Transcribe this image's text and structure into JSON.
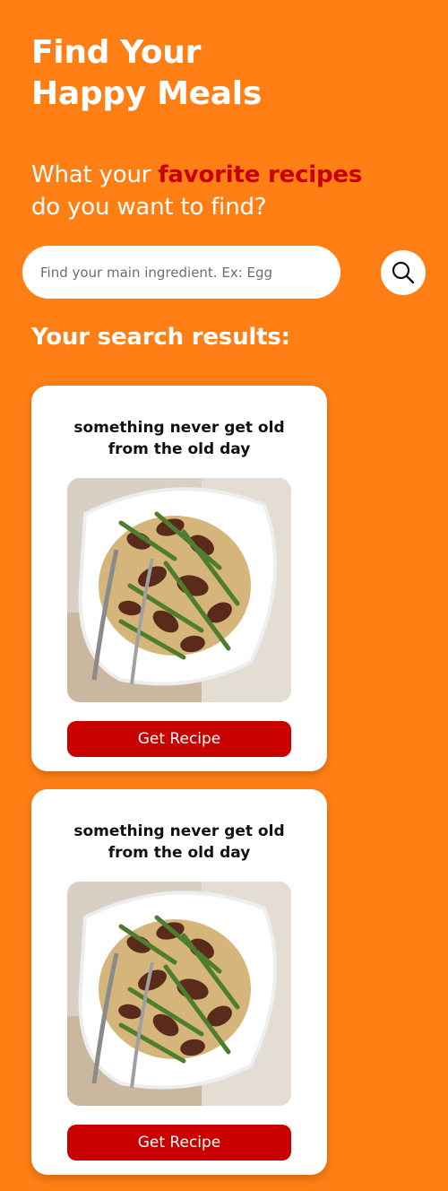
{
  "header": {
    "title_line1": "Find Your",
    "title_line2": "Happy Meals",
    "subtitle_prefix": "What your ",
    "subtitle_accent": "favorite recipes",
    "subtitle_line2": "do you want to find?"
  },
  "search": {
    "placeholder": "Find your main ingredient. Ex: Egg",
    "value": "",
    "button_icon": "search-icon"
  },
  "results": {
    "heading": "Your search results:",
    "items": [
      {
        "title_line1": "something never get old",
        "title_line2": "from the old day",
        "image": "beef-asparagus-noodle-dish-photo",
        "button_label": "Get Recipe"
      },
      {
        "title_line1": "something never get old",
        "title_line2": "from the old day",
        "image": "beef-asparagus-noodle-dish-photo",
        "button_label": "Get Recipe"
      }
    ]
  },
  "colors": {
    "background": "#FF7F14",
    "accent": "#C80000",
    "card": "#FFFFFF",
    "text_light": "#FFFFFF",
    "text_dark": "#111111"
  }
}
